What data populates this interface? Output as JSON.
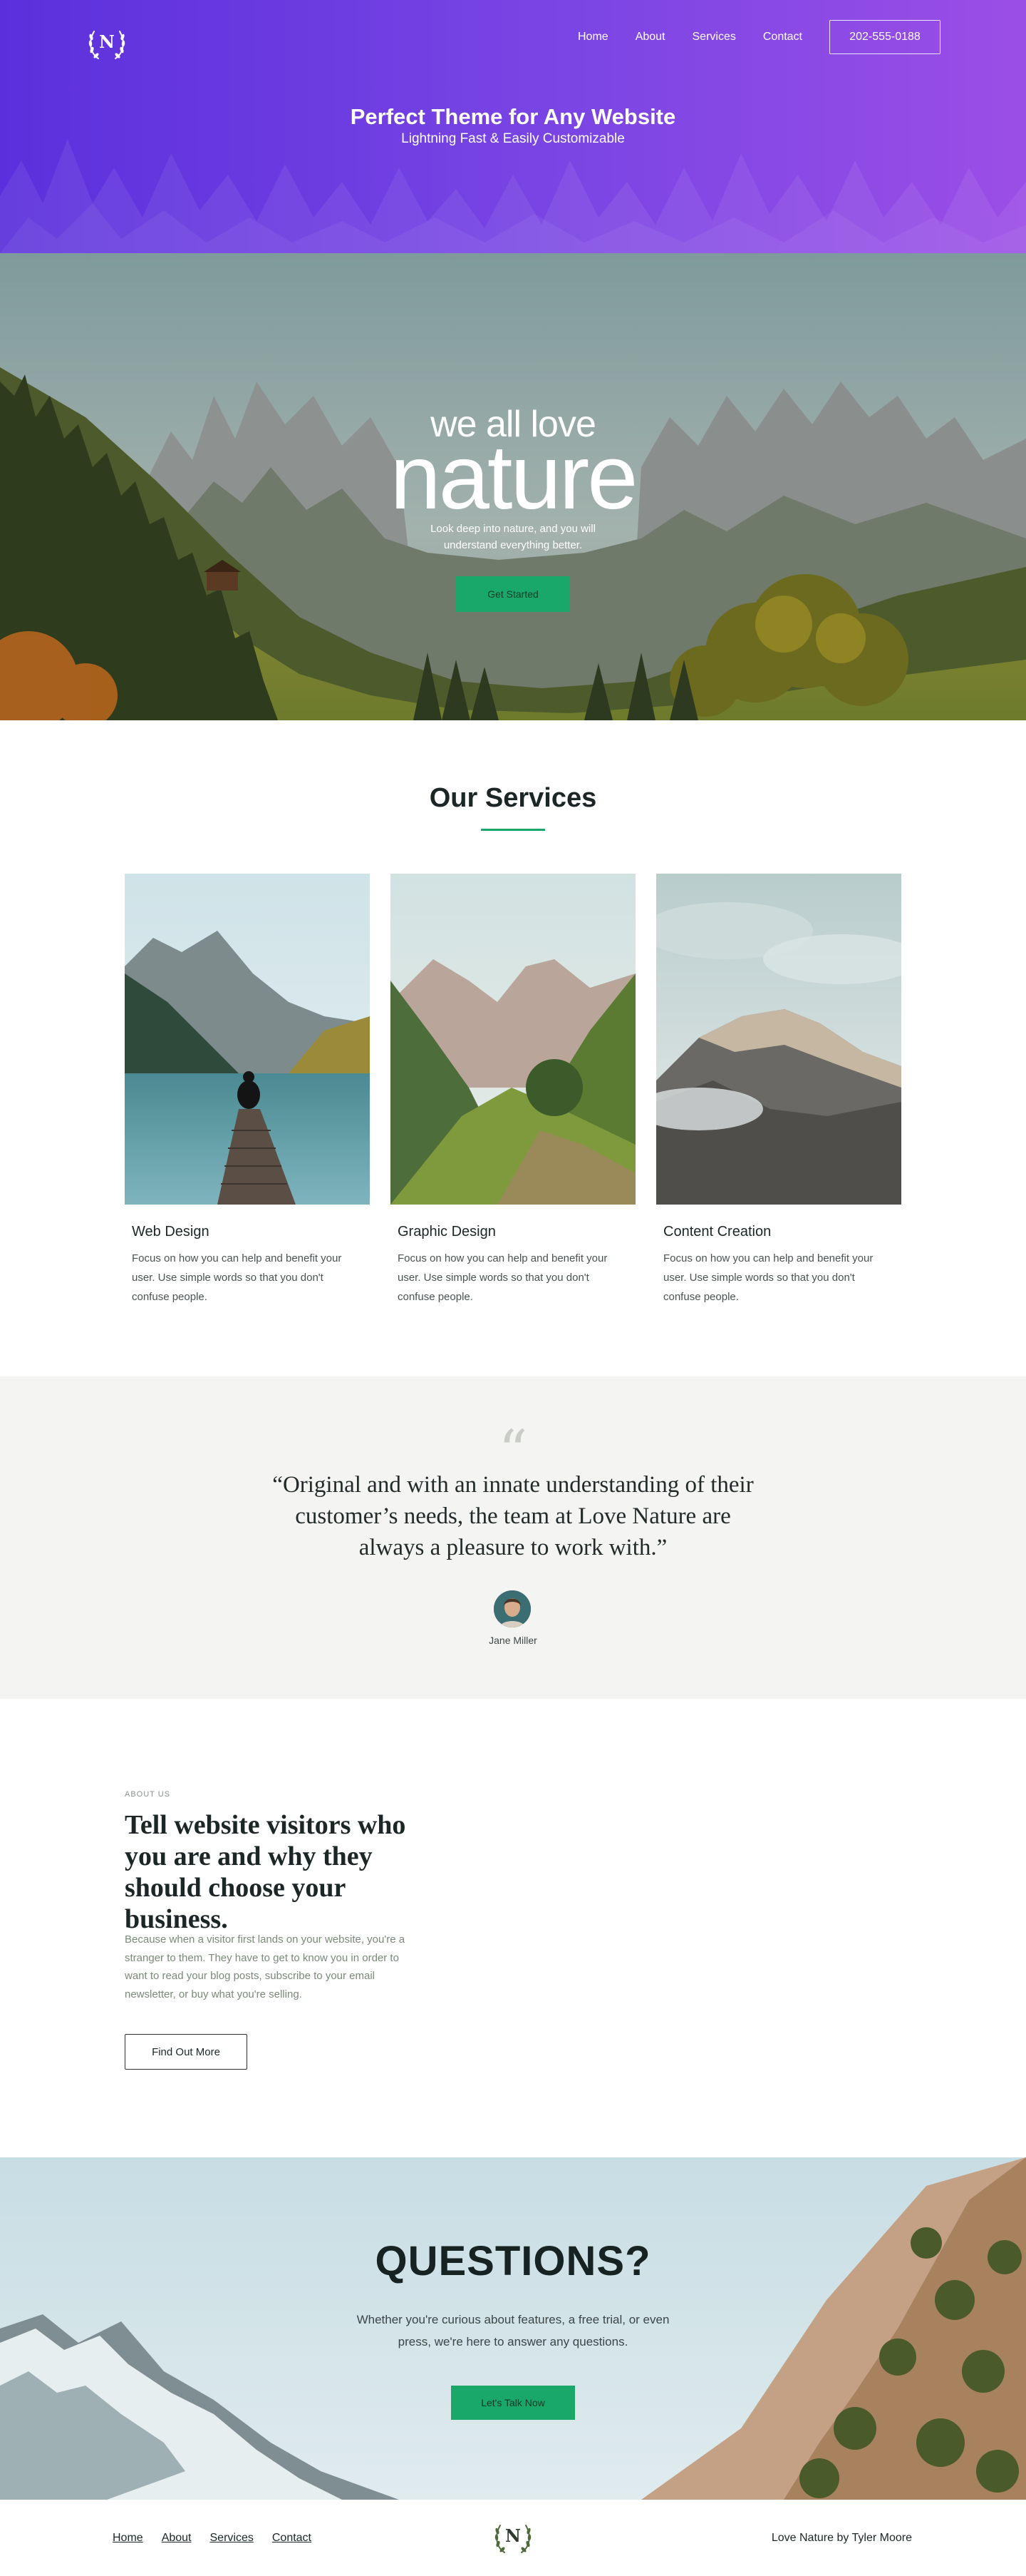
{
  "brand": {
    "logo_letter": "N"
  },
  "nav": {
    "links": [
      "Home",
      "About",
      "Services",
      "Contact"
    ],
    "phone": "202-555-0188"
  },
  "header": {
    "title": "Perfect Theme for Any Website",
    "subtitle": "Lightning Fast & Easily Customizable"
  },
  "hero": {
    "line1": "we all love",
    "line2": "nature",
    "text": "Look deep into nature, and you will understand everything better.",
    "button": "Get Started"
  },
  "services": {
    "title": "Our Services",
    "items": [
      {
        "title": "Web Design",
        "text": "Focus on how you can help and benefit your user. Use simple words so that you don't confuse people."
      },
      {
        "title": "Graphic Design",
        "text": "Focus on how you can help and benefit your user. Use simple words so that you don't confuse people."
      },
      {
        "title": "Content Creation",
        "text": "Focus on how you can help and benefit your user. Use simple words so that you don't confuse people."
      }
    ]
  },
  "testimonial": {
    "quote": "“Original and with an innate understanding of their customer’s needs, the team at Love Nature are always a pleasure to work with.”",
    "author": "Jane Miller"
  },
  "about": {
    "kicker": "ABOUT US",
    "title": "Tell website visitors who you are and why they should choose your business.",
    "text": "Because when a visitor first lands on your website, you're a stranger to them. They have to get to know you in order to want to read your blog posts, subscribe to your email newsletter, or buy what you're selling.",
    "button": "Find Out More"
  },
  "questions": {
    "title": "QUESTIONS?",
    "text": "Whether you're curious about features, a free trial, or even press, we're here to answer any questions.",
    "button": "Let's Talk Now"
  },
  "footer": {
    "links": [
      "Home",
      "About",
      "Services",
      "Contact"
    ],
    "credit": "Love Nature by Tyler Moore"
  },
  "colors": {
    "header_gradient_start": "#5b30dc",
    "header_gradient_end": "#9b4ee6",
    "accent_green": "#1aa86a",
    "testimonial_bg": "#f4f5f3"
  },
  "icons": [
    "laurel-wreath-logo-icon",
    "quote-icon"
  ]
}
